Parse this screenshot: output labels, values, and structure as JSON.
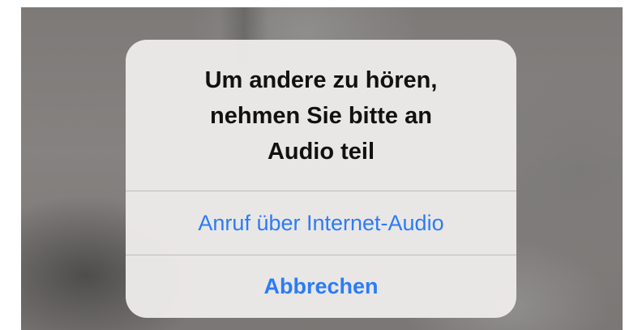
{
  "alert": {
    "message_lines": [
      "Um andere zu hören,",
      "nehmen Sie bitte an",
      "Audio teil"
    ],
    "actions": {
      "internet_audio_label": "Anruf über Internet-Audio",
      "cancel_label": "Abbrechen"
    }
  },
  "colors": {
    "action_text": "#2c7cf6",
    "alert_background": "#eceae9",
    "divider": "#bdbcbc",
    "message_text": "#111111"
  }
}
